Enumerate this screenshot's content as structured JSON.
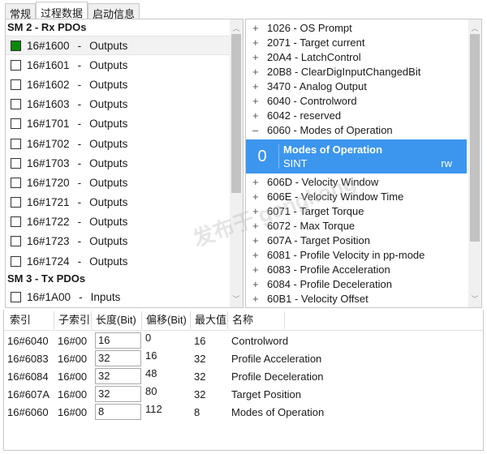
{
  "tabs": [
    {
      "label": "常规"
    },
    {
      "label": "过程数据",
      "active": true
    },
    {
      "label": "启动信息"
    }
  ],
  "left": {
    "sm2": "SM 2 - Rx PDOs",
    "rx": [
      {
        "index": "16#1600",
        "name": "Outputs",
        "checked": true
      },
      {
        "index": "16#1601",
        "name": "Outputs",
        "checked": false
      },
      {
        "index": "16#1602",
        "name": "Outputs",
        "checked": false
      },
      {
        "index": "16#1603",
        "name": "Outputs",
        "checked": false
      },
      {
        "index": "16#1701",
        "name": "Outputs",
        "checked": false
      },
      {
        "index": "16#1702",
        "name": "Outputs",
        "checked": false
      },
      {
        "index": "16#1703",
        "name": "Outputs",
        "checked": false
      },
      {
        "index": "16#1720",
        "name": "Outputs",
        "checked": false
      },
      {
        "index": "16#1721",
        "name": "Outputs",
        "checked": false
      },
      {
        "index": "16#1722",
        "name": "Outputs",
        "checked": false
      },
      {
        "index": "16#1723",
        "name": "Outputs",
        "checked": false
      },
      {
        "index": "16#1724",
        "name": "Outputs",
        "checked": false
      }
    ],
    "sm3": "SM 3 - Tx PDOs",
    "tx": [
      {
        "index": "16#1A00",
        "name": "Inputs",
        "checked": false
      }
    ],
    "separator": "-"
  },
  "right": {
    "before": [
      {
        "sign": "+",
        "label": "1026 - OS Prompt"
      },
      {
        "sign": "+",
        "label": "2071 - Target current"
      },
      {
        "sign": "+",
        "label": "20A4 - LatchControl"
      },
      {
        "sign": "+",
        "label": "20B8 - ClearDigInputChangedBit"
      },
      {
        "sign": "+",
        "label": "3470 - Analog Output"
      },
      {
        "sign": "+",
        "label": "6040 - Controlword"
      },
      {
        "sign": "+",
        "label": "6042 - reserved"
      },
      {
        "sign": "–",
        "label": "6060 - Modes of Operation"
      }
    ],
    "selected": {
      "sub": "0",
      "name": "Modes of Operation",
      "type": "SINT",
      "access": "rw",
      "color": "#3c96ee"
    },
    "after": [
      {
        "sign": "+",
        "label": "606D - Velocity Window"
      },
      {
        "sign": "+",
        "label": "606E - Velocity Window Time"
      },
      {
        "sign": "+",
        "label": "6071 - Target Torque"
      },
      {
        "sign": "+",
        "label": "6072 - Max Torque"
      },
      {
        "sign": "+",
        "label": "607A - Target Position"
      },
      {
        "sign": "+",
        "label": "6081 - Profile Velocity in pp-mode"
      },
      {
        "sign": "+",
        "label": "6083 - Profile Acceleration"
      },
      {
        "sign": "+",
        "label": "6084 - Profile Deceleration"
      },
      {
        "sign": "+",
        "label": "60B1 - Velocity Offset"
      }
    ]
  },
  "table": {
    "headers": [
      "索引",
      "子索引",
      "长度(Bit)",
      "偏移(Bit)",
      "最大值",
      "名称"
    ],
    "rows": [
      [
        "16#6040",
        "16#00",
        "16",
        "0",
        "16",
        "Controlword"
      ],
      [
        "16#6083",
        "16#00",
        "32",
        "16",
        "32",
        "Profile Acceleration"
      ],
      [
        "16#6084",
        "16#00",
        "32",
        "48",
        "32",
        "Profile Deceleration"
      ],
      [
        "16#607A",
        "16#00",
        "32",
        "80",
        "32",
        "Target Position"
      ],
      [
        "16#6060",
        "16#00",
        "8",
        "112",
        "8",
        "Modes of Operation"
      ]
    ]
  },
  "watermark": "发布于 gongkong"
}
